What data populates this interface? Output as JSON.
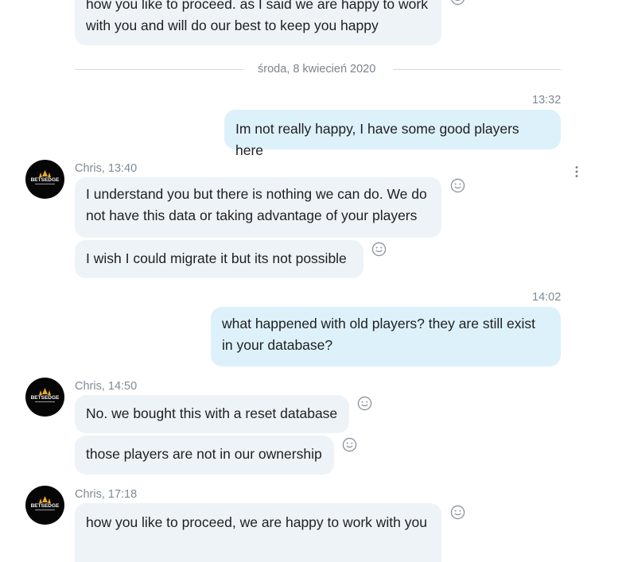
{
  "messages": [
    {
      "id": "m0",
      "text": "how you like to proceed. as I said we are happy to work with you and will do our best to keep you happy"
    },
    {
      "id": "m1",
      "time": "13:32",
      "text": "Im not really happy, I have some good players here"
    },
    {
      "id": "m2",
      "header": "Chris, 13:40",
      "text": "I understand you but there is nothing we can do. We do not have this data or taking advantage of your players"
    },
    {
      "id": "m3",
      "text": "I wish I could migrate it but its not possible"
    },
    {
      "id": "m4",
      "time": "14:02",
      "text": "what happened with old players? they are still exist in your database?"
    },
    {
      "id": "m5",
      "header": "Chris, 14:50",
      "text": "No. we bought this with a reset database"
    },
    {
      "id": "m6",
      "text": "those players are not in our ownership"
    },
    {
      "id": "m7",
      "header": "Chris, 17:18",
      "text": "how you like to proceed, we are happy to work with you"
    }
  ],
  "date_divider": "środa, 8 kwiecień 2020",
  "avatar_brand": "BETSEDGE",
  "icons": {
    "react": "smiley-icon",
    "more": "more-vertical-icon"
  },
  "colors": {
    "incoming": "#eef3f8",
    "outgoing": "#ddf1fb",
    "meta": "#808a94"
  }
}
